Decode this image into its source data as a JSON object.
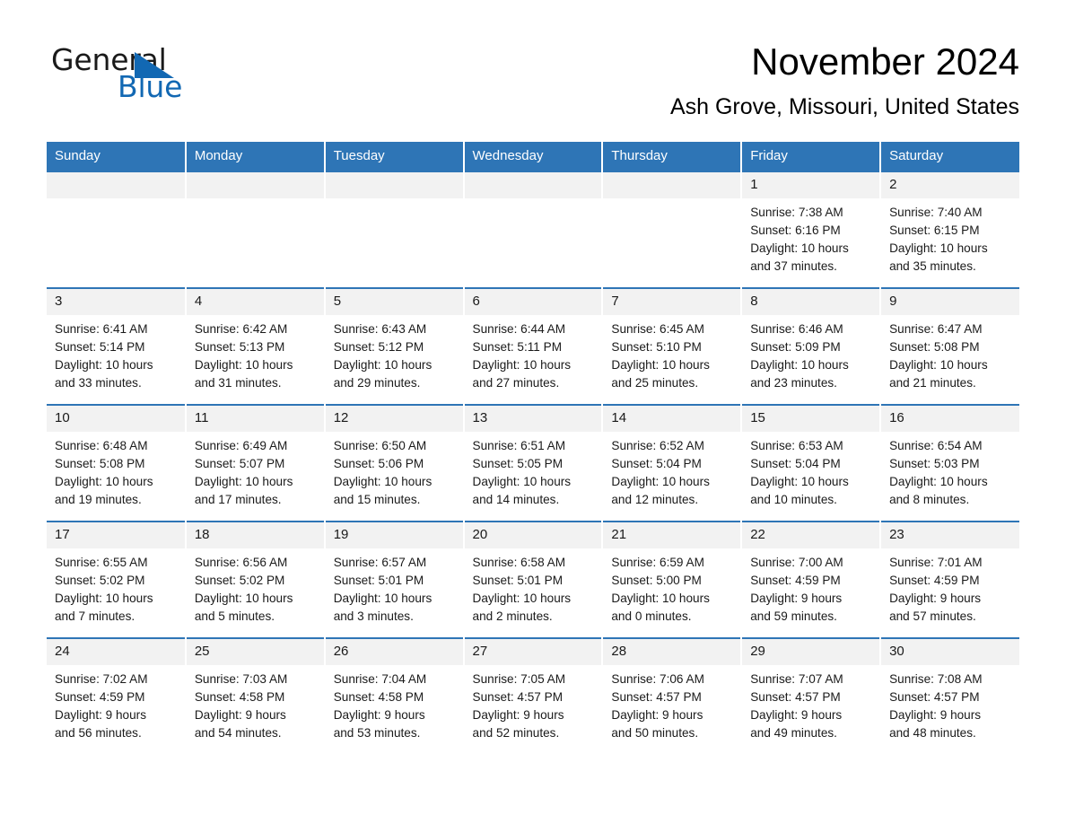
{
  "brand": {
    "name_part1": "General",
    "name_part2": "Blue",
    "triangle_icon": "blue-triangle-icon",
    "accent_color": "#1268b3"
  },
  "header": {
    "month_title": "November 2024",
    "location": "Ash Grove, Missouri, United States"
  },
  "theme": {
    "header_blue": "#2e75b6",
    "daynum_gray": "#f2f2f2",
    "text_black": "#1a1a1a"
  },
  "calendar": {
    "weekday_headers": [
      "Sunday",
      "Monday",
      "Tuesday",
      "Wednesday",
      "Thursday",
      "Friday",
      "Saturday"
    ],
    "weeks": [
      [
        {
          "day": "",
          "sunrise": "",
          "sunset": "",
          "daylight_line1": "",
          "daylight_line2": ""
        },
        {
          "day": "",
          "sunrise": "",
          "sunset": "",
          "daylight_line1": "",
          "daylight_line2": ""
        },
        {
          "day": "",
          "sunrise": "",
          "sunset": "",
          "daylight_line1": "",
          "daylight_line2": ""
        },
        {
          "day": "",
          "sunrise": "",
          "sunset": "",
          "daylight_line1": "",
          "daylight_line2": ""
        },
        {
          "day": "",
          "sunrise": "",
          "sunset": "",
          "daylight_line1": "",
          "daylight_line2": ""
        },
        {
          "day": "1",
          "sunrise": "Sunrise: 7:38 AM",
          "sunset": "Sunset: 6:16 PM",
          "daylight_line1": "Daylight: 10 hours",
          "daylight_line2": "and 37 minutes."
        },
        {
          "day": "2",
          "sunrise": "Sunrise: 7:40 AM",
          "sunset": "Sunset: 6:15 PM",
          "daylight_line1": "Daylight: 10 hours",
          "daylight_line2": "and 35 minutes."
        }
      ],
      [
        {
          "day": "3",
          "sunrise": "Sunrise: 6:41 AM",
          "sunset": "Sunset: 5:14 PM",
          "daylight_line1": "Daylight: 10 hours",
          "daylight_line2": "and 33 minutes."
        },
        {
          "day": "4",
          "sunrise": "Sunrise: 6:42 AM",
          "sunset": "Sunset: 5:13 PM",
          "daylight_line1": "Daylight: 10 hours",
          "daylight_line2": "and 31 minutes."
        },
        {
          "day": "5",
          "sunrise": "Sunrise: 6:43 AM",
          "sunset": "Sunset: 5:12 PM",
          "daylight_line1": "Daylight: 10 hours",
          "daylight_line2": "and 29 minutes."
        },
        {
          "day": "6",
          "sunrise": "Sunrise: 6:44 AM",
          "sunset": "Sunset: 5:11 PM",
          "daylight_line1": "Daylight: 10 hours",
          "daylight_line2": "and 27 minutes."
        },
        {
          "day": "7",
          "sunrise": "Sunrise: 6:45 AM",
          "sunset": "Sunset: 5:10 PM",
          "daylight_line1": "Daylight: 10 hours",
          "daylight_line2": "and 25 minutes."
        },
        {
          "day": "8",
          "sunrise": "Sunrise: 6:46 AM",
          "sunset": "Sunset: 5:09 PM",
          "daylight_line1": "Daylight: 10 hours",
          "daylight_line2": "and 23 minutes."
        },
        {
          "day": "9",
          "sunrise": "Sunrise: 6:47 AM",
          "sunset": "Sunset: 5:08 PM",
          "daylight_line1": "Daylight: 10 hours",
          "daylight_line2": "and 21 minutes."
        }
      ],
      [
        {
          "day": "10",
          "sunrise": "Sunrise: 6:48 AM",
          "sunset": "Sunset: 5:08 PM",
          "daylight_line1": "Daylight: 10 hours",
          "daylight_line2": "and 19 minutes."
        },
        {
          "day": "11",
          "sunrise": "Sunrise: 6:49 AM",
          "sunset": "Sunset: 5:07 PM",
          "daylight_line1": "Daylight: 10 hours",
          "daylight_line2": "and 17 minutes."
        },
        {
          "day": "12",
          "sunrise": "Sunrise: 6:50 AM",
          "sunset": "Sunset: 5:06 PM",
          "daylight_line1": "Daylight: 10 hours",
          "daylight_line2": "and 15 minutes."
        },
        {
          "day": "13",
          "sunrise": "Sunrise: 6:51 AM",
          "sunset": "Sunset: 5:05 PM",
          "daylight_line1": "Daylight: 10 hours",
          "daylight_line2": "and 14 minutes."
        },
        {
          "day": "14",
          "sunrise": "Sunrise: 6:52 AM",
          "sunset": "Sunset: 5:04 PM",
          "daylight_line1": "Daylight: 10 hours",
          "daylight_line2": "and 12 minutes."
        },
        {
          "day": "15",
          "sunrise": "Sunrise: 6:53 AM",
          "sunset": "Sunset: 5:04 PM",
          "daylight_line1": "Daylight: 10 hours",
          "daylight_line2": "and 10 minutes."
        },
        {
          "day": "16",
          "sunrise": "Sunrise: 6:54 AM",
          "sunset": "Sunset: 5:03 PM",
          "daylight_line1": "Daylight: 10 hours",
          "daylight_line2": "and 8 minutes."
        }
      ],
      [
        {
          "day": "17",
          "sunrise": "Sunrise: 6:55 AM",
          "sunset": "Sunset: 5:02 PM",
          "daylight_line1": "Daylight: 10 hours",
          "daylight_line2": "and 7 minutes."
        },
        {
          "day": "18",
          "sunrise": "Sunrise: 6:56 AM",
          "sunset": "Sunset: 5:02 PM",
          "daylight_line1": "Daylight: 10 hours",
          "daylight_line2": "and 5 minutes."
        },
        {
          "day": "19",
          "sunrise": "Sunrise: 6:57 AM",
          "sunset": "Sunset: 5:01 PM",
          "daylight_line1": "Daylight: 10 hours",
          "daylight_line2": "and 3 minutes."
        },
        {
          "day": "20",
          "sunrise": "Sunrise: 6:58 AM",
          "sunset": "Sunset: 5:01 PM",
          "daylight_line1": "Daylight: 10 hours",
          "daylight_line2": "and 2 minutes."
        },
        {
          "day": "21",
          "sunrise": "Sunrise: 6:59 AM",
          "sunset": "Sunset: 5:00 PM",
          "daylight_line1": "Daylight: 10 hours",
          "daylight_line2": "and 0 minutes."
        },
        {
          "day": "22",
          "sunrise": "Sunrise: 7:00 AM",
          "sunset": "Sunset: 4:59 PM",
          "daylight_line1": "Daylight: 9 hours",
          "daylight_line2": "and 59 minutes."
        },
        {
          "day": "23",
          "sunrise": "Sunrise: 7:01 AM",
          "sunset": "Sunset: 4:59 PM",
          "daylight_line1": "Daylight: 9 hours",
          "daylight_line2": "and 57 minutes."
        }
      ],
      [
        {
          "day": "24",
          "sunrise": "Sunrise: 7:02 AM",
          "sunset": "Sunset: 4:59 PM",
          "daylight_line1": "Daylight: 9 hours",
          "daylight_line2": "and 56 minutes."
        },
        {
          "day": "25",
          "sunrise": "Sunrise: 7:03 AM",
          "sunset": "Sunset: 4:58 PM",
          "daylight_line1": "Daylight: 9 hours",
          "daylight_line2": "and 54 minutes."
        },
        {
          "day": "26",
          "sunrise": "Sunrise: 7:04 AM",
          "sunset": "Sunset: 4:58 PM",
          "daylight_line1": "Daylight: 9 hours",
          "daylight_line2": "and 53 minutes."
        },
        {
          "day": "27",
          "sunrise": "Sunrise: 7:05 AM",
          "sunset": "Sunset: 4:57 PM",
          "daylight_line1": "Daylight: 9 hours",
          "daylight_line2": "and 52 minutes."
        },
        {
          "day": "28",
          "sunrise": "Sunrise: 7:06 AM",
          "sunset": "Sunset: 4:57 PM",
          "daylight_line1": "Daylight: 9 hours",
          "daylight_line2": "and 50 minutes."
        },
        {
          "day": "29",
          "sunrise": "Sunrise: 7:07 AM",
          "sunset": "Sunset: 4:57 PM",
          "daylight_line1": "Daylight: 9 hours",
          "daylight_line2": "and 49 minutes."
        },
        {
          "day": "30",
          "sunrise": "Sunrise: 7:08 AM",
          "sunset": "Sunset: 4:57 PM",
          "daylight_line1": "Daylight: 9 hours",
          "daylight_line2": "and 48 minutes."
        }
      ]
    ]
  }
}
